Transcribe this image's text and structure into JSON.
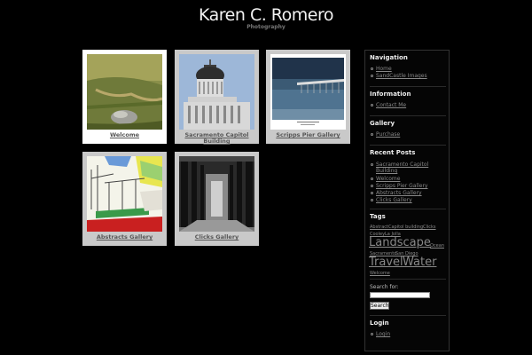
{
  "header": {
    "title": "Karen C. Romero",
    "tagline": "Photography"
  },
  "gallery": [
    {
      "caption": "Welcome"
    },
    {
      "caption": "Sacramento Capitol Building"
    },
    {
      "caption": "Scripps Pier Gallery"
    },
    {
      "caption": "Abstracts Gallery"
    },
    {
      "caption": "Clicks Gallery"
    }
  ],
  "sidebar": {
    "navigation": {
      "heading": "Navigation",
      "items": [
        "Home",
        "SandCastle Images"
      ]
    },
    "information": {
      "heading": "Information",
      "items": [
        "Contact Me"
      ]
    },
    "gallery": {
      "heading": "Gallery",
      "items": [
        "Purchase"
      ]
    },
    "recent_posts": {
      "heading": "Recent Posts",
      "items": [
        "Sacramento Capitol Building",
        "Welcome",
        "Scripps Pier Gallery",
        "Abstracts Gallery",
        "Clicks Gallery"
      ]
    },
    "tags": {
      "heading": "Tags",
      "items": [
        "Abstract",
        "Capitol building",
        "Clicks",
        "Cooley",
        "La Jolla",
        "Landscape",
        "Ocean",
        "Sacramento",
        "San Diego",
        "Travel",
        "Water",
        "Welcome"
      ]
    },
    "search": {
      "label": "Search for:",
      "value": "",
      "button": "Search"
    },
    "login": {
      "heading": "Login",
      "items": [
        "Login"
      ]
    }
  }
}
